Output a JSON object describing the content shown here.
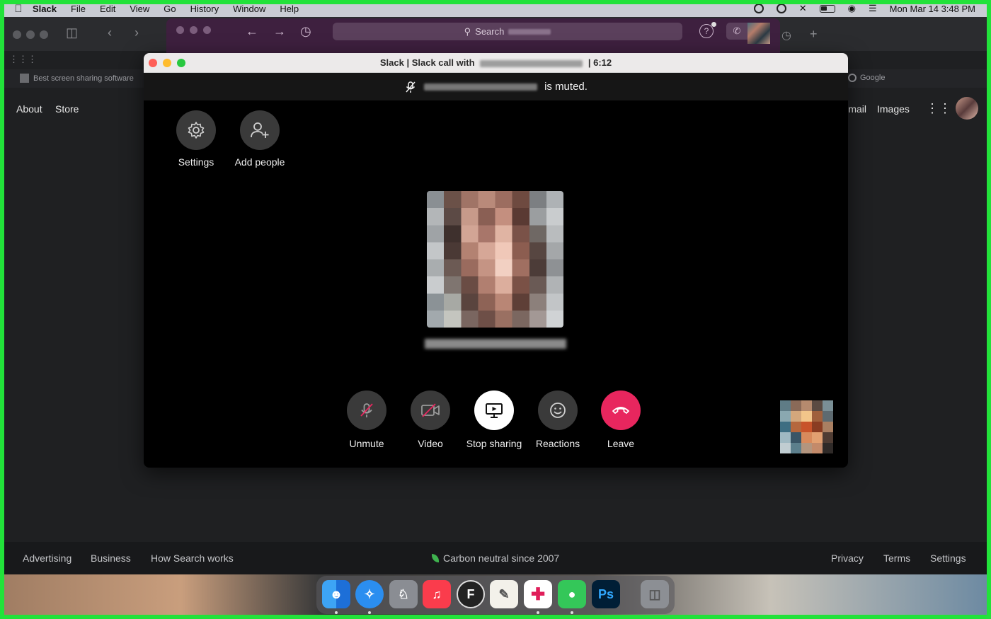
{
  "menubar": {
    "app_name": "Slack",
    "items": [
      "File",
      "Edit",
      "View",
      "Go",
      "History",
      "Window",
      "Help"
    ],
    "datetime": "Mon Mar 14  3:48 PM"
  },
  "browser": {
    "bookmark_left": "Best screen sharing software",
    "bookmark_right": "Google",
    "nav_left": [
      "About",
      "Store"
    ],
    "nav_right": [
      "Gmail",
      "Images"
    ],
    "footer": {
      "left": [
        "Advertising",
        "Business",
        "How Search works"
      ],
      "center": "Carbon neutral since 2007",
      "right": [
        "Privacy",
        "Terms",
        "Settings"
      ]
    }
  },
  "slack_main": {
    "search_label": "Search"
  },
  "call": {
    "title_prefix": "Slack | Slack call with",
    "title_suffix": "| 6:12",
    "muted_text": "is muted.",
    "top_buttons": {
      "settings": "Settings",
      "add_people": "Add people"
    },
    "controls": {
      "unmute": "Unmute",
      "video": "Video",
      "stop_sharing": "Stop sharing",
      "reactions": "Reactions",
      "leave": "Leave"
    }
  },
  "colors": {
    "leave_red": "#e8265e",
    "slack_purple": "#3e203f",
    "frame_green": "#22e23a"
  },
  "dock": {
    "apps": [
      "finder-icon",
      "safari-icon",
      "launchpad-icon",
      "music-icon",
      "font-app-icon",
      "textedit-icon",
      "slack-icon",
      "messages-icon",
      "photoshop-icon",
      "trash-icon"
    ]
  }
}
